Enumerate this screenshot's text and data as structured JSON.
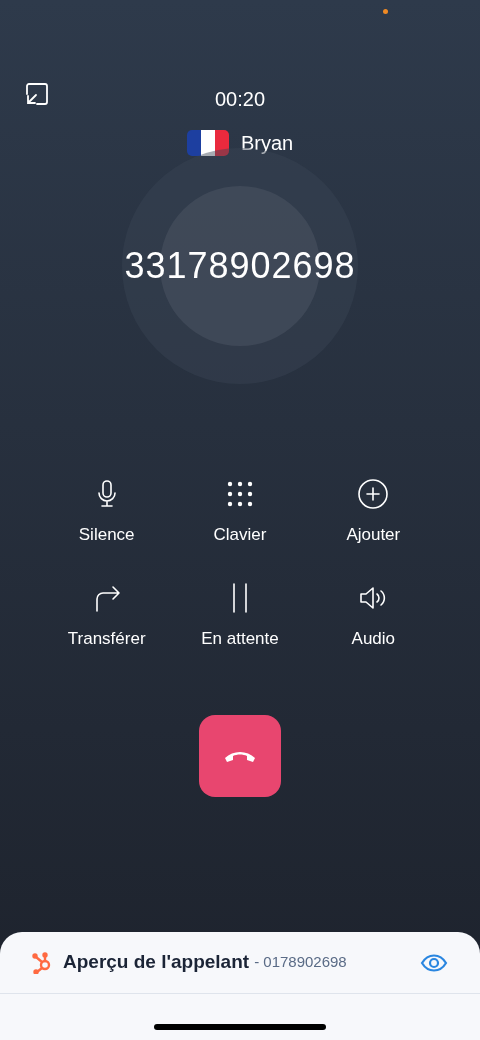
{
  "call": {
    "timer": "00:20",
    "contact_name": "Bryan",
    "number": "33178902698"
  },
  "actions": [
    {
      "kind": "mic",
      "label": "Silence"
    },
    {
      "kind": "keypad",
      "label": "Clavier"
    },
    {
      "kind": "add",
      "label": "Ajouter"
    },
    {
      "kind": "transfer",
      "label": "Transférer"
    },
    {
      "kind": "hold",
      "label": "En attente"
    },
    {
      "kind": "speaker",
      "label": "Audio"
    }
  ],
  "caller_preview": {
    "title": "Aperçu de l'appelant",
    "number": "- 0178902698"
  }
}
